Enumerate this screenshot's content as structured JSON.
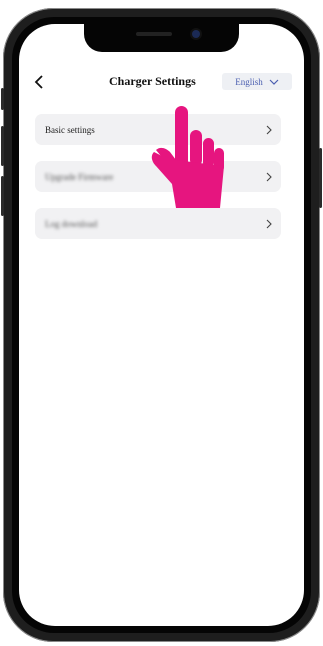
{
  "header": {
    "back_icon": "chevron-left-icon",
    "title": "Charger Settings",
    "language": {
      "selected": "English",
      "icon": "chevron-down-icon"
    }
  },
  "menu": {
    "items": [
      {
        "label": "Basic settings",
        "icon": "chevron-right-icon",
        "blurred": false
      },
      {
        "label": "Upgrade Firmware",
        "icon": "chevron-right-icon",
        "blurred": true
      },
      {
        "label": "Log download",
        "icon": "chevron-right-icon",
        "blurred": true
      }
    ]
  },
  "overlay": {
    "icon": "pointing-hand-icon",
    "color": "#e6157f"
  },
  "colors": {
    "accent": "#4a5eb0",
    "row_bg": "#f1f1f3",
    "frame": "#1e1e1e"
  }
}
